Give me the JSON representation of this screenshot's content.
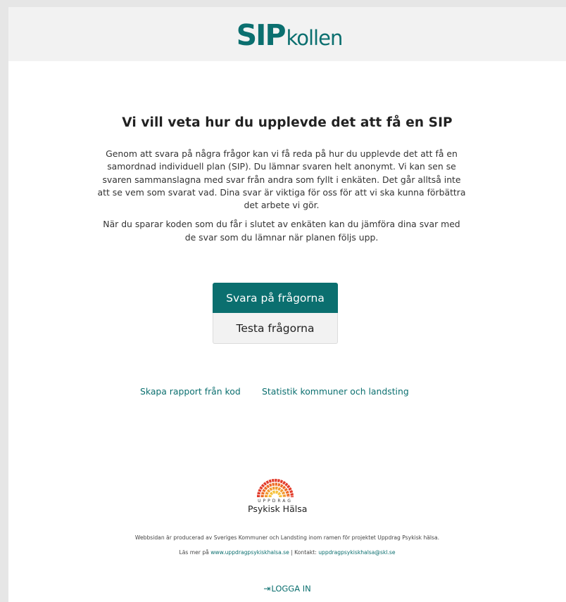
{
  "header": {
    "logo_sip": "SIP",
    "logo_kollen": "kollen"
  },
  "main": {
    "title": "Vi vill veta hur du upplevde det att få en SIP",
    "intro_p1": "Genom att svara på några frågor kan vi få reda på hur du upplevde det att få en samordnad individuell plan (SIP). Du lämnar svaren helt anonymt. Vi kan sen se svaren sammanslagna med svar från andra som fyllt i enkäten. Det går alltså inte att se vem som svarat vad. Dina svar är viktiga för oss för att vi ska kunna förbättra det arbete vi gör.",
    "intro_p2": "När du sparar koden som du får i slutet av enkäten kan du jämföra dina svar med de svar som du lämnar när planen följs upp.",
    "primary_button": "Svara på frågorna",
    "secondary_button": "Testa frågorna"
  },
  "links": {
    "report": "Skapa rapport från kod",
    "stats": "Statistik kommuner och landsting"
  },
  "partner_logo": {
    "small_text": "UPPDRAG",
    "big_text": "Psykisk Hälsa",
    "colors": [
      "#e23b2a",
      "#ee6a24",
      "#f29a2e",
      "#f6c33d"
    ]
  },
  "footer": {
    "line1": "Webbsidan är producerad av Sveriges Kommuner och Landsting inom ramen för projektet Uppdrag Psykisk hälsa.",
    "line2_prefix": "Läs mer på ",
    "website": "www.uppdragpsykiskhalsa.se",
    "separator": " | Kontakt: ",
    "email": "uppdragpsykiskhalsa@skl.se"
  },
  "login": {
    "icon": "sign-in-icon",
    "label": "LOGGA IN"
  },
  "colors": {
    "accent": "#0b6f6f",
    "header_bg": "#f2f2f2",
    "page_bg": "#e6e6e6"
  }
}
